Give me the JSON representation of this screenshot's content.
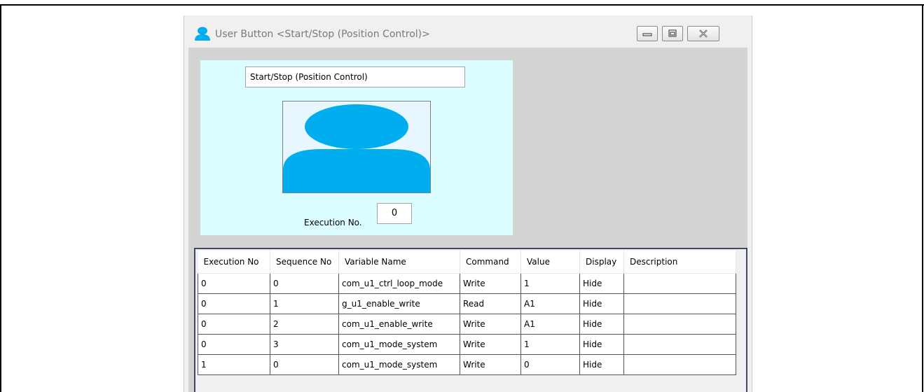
{
  "window": {
    "title": "User Button <Start/Stop (Position Control)>",
    "controls": [
      "minimize",
      "maximize",
      "close"
    ]
  },
  "button_panel": {
    "button_name": "Start/Stop (Position Control)",
    "execution_label": "Execution No.",
    "execution_value": "0",
    "image_color": "#00aeef"
  },
  "grid": {
    "columns": [
      "Execution No",
      "Sequence No",
      "Variable Name",
      "Command",
      "Value",
      "Display",
      "Description"
    ],
    "rows": [
      [
        "0",
        "0",
        "com_u1_ctrl_loop_mode",
        "Write",
        "1",
        "Hide",
        ""
      ],
      [
        "0",
        "1",
        "g_u1_enable_write",
        "Read",
        "A1",
        "Hide",
        ""
      ],
      [
        "0",
        "2",
        "com_u1_enable_write",
        "Write",
        "A1",
        "Hide",
        ""
      ],
      [
        "0",
        "3",
        "com_u1_mode_system",
        "Write",
        "1",
        "Hide",
        ""
      ],
      [
        "1",
        "0",
        "com_u1_mode_system",
        "Write",
        "0",
        "Hide",
        ""
      ]
    ]
  }
}
